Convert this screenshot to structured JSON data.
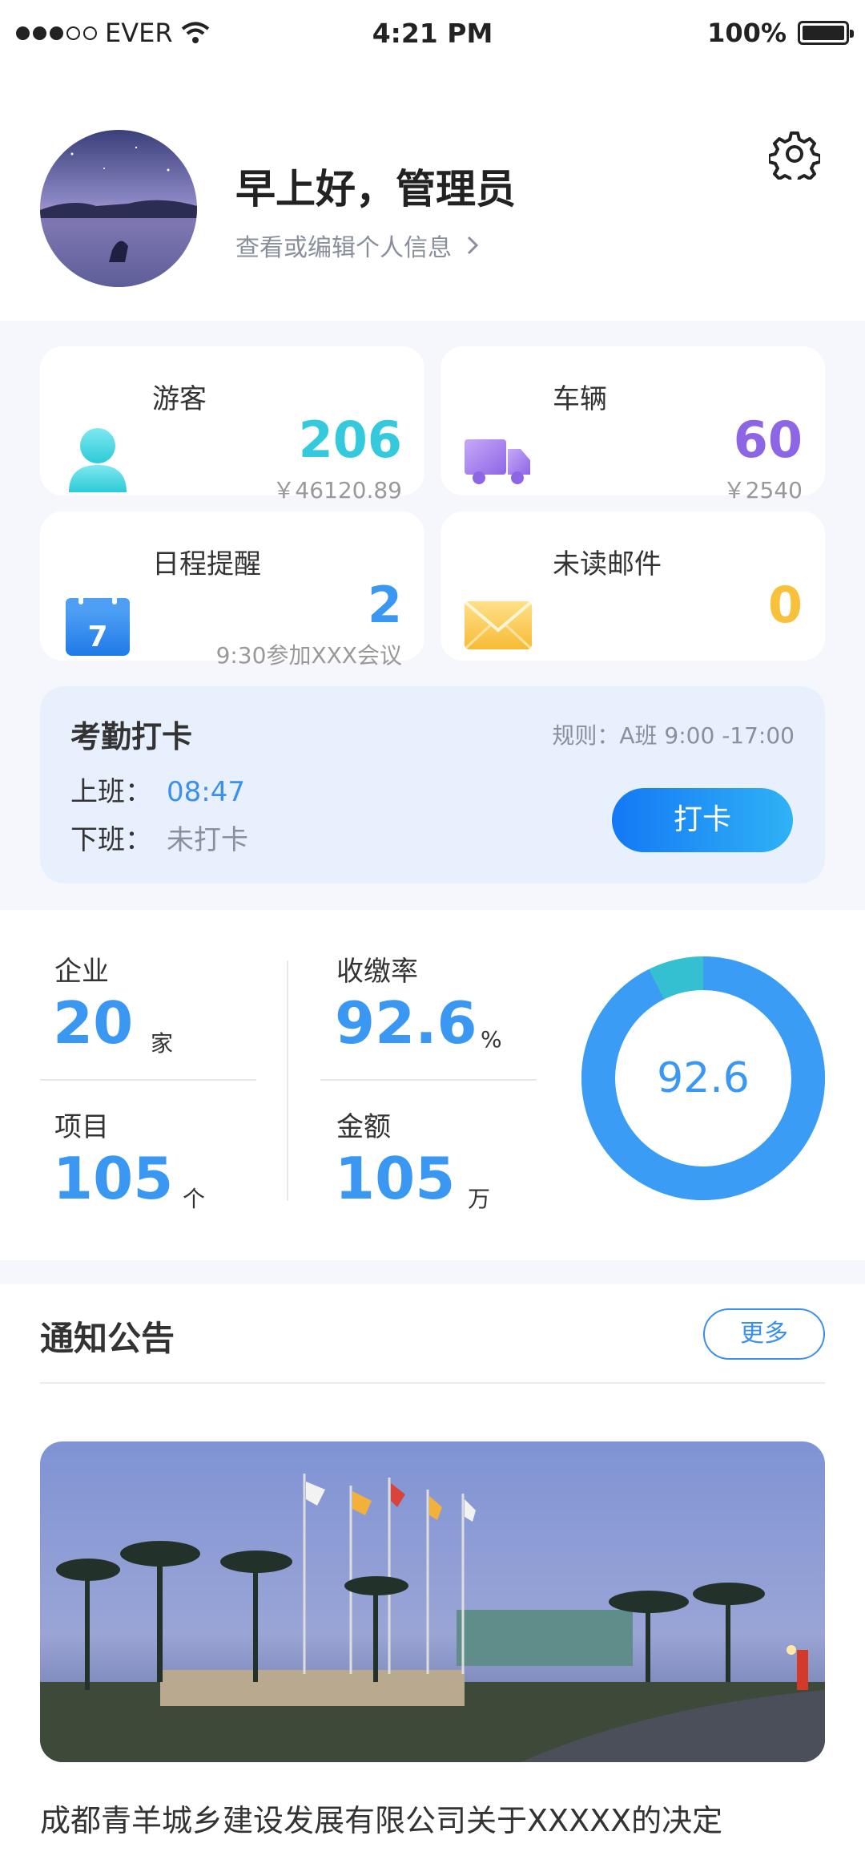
{
  "status_bar": {
    "carrier": "EVER",
    "time": "4:21 PM",
    "battery": "100%"
  },
  "profile": {
    "greeting": "早上好，管理员",
    "edit_link": "查看或编辑个人信息"
  },
  "cards": {
    "visitors": {
      "title": "游客",
      "value": "206",
      "sub": "￥46120.89",
      "color": "#34c9dd"
    },
    "vehicles": {
      "title": "车辆",
      "value": "60",
      "sub": "￥2540",
      "color": "#8d66e6"
    },
    "schedule": {
      "title": "日程提醒",
      "value": "2",
      "sub": "9:30参加XXX会议",
      "color": "#3a97f2",
      "icon_day": "7"
    },
    "mail": {
      "title": "未读邮件",
      "value": "0",
      "color": "#f7c13b"
    }
  },
  "attendance": {
    "title": "考勤打卡",
    "rule": "规则：A班 9:00 -17:00",
    "on_label": "上班：",
    "on_value": "08:47",
    "off_label": "下班：",
    "off_value": "未打卡",
    "button": "打卡"
  },
  "stats": {
    "enterprise": {
      "label": "企业",
      "value": "20",
      "unit": "家"
    },
    "project": {
      "label": "项目",
      "value": "105",
      "unit": "个"
    },
    "rate": {
      "label": "收缴率",
      "value": "92.6",
      "unit": "%"
    },
    "amount": {
      "label": "金额",
      "value": "105",
      "unit": "万"
    },
    "donut": {
      "value": "92.6",
      "fraction": 0.926,
      "color_main": "#3a9cf5",
      "color_rest": "#34c0d0"
    }
  },
  "notice": {
    "title": "通知公告",
    "more": "更多",
    "headline": "成都青羊城乡建设发展有限公司关于XXXXX的决定"
  }
}
